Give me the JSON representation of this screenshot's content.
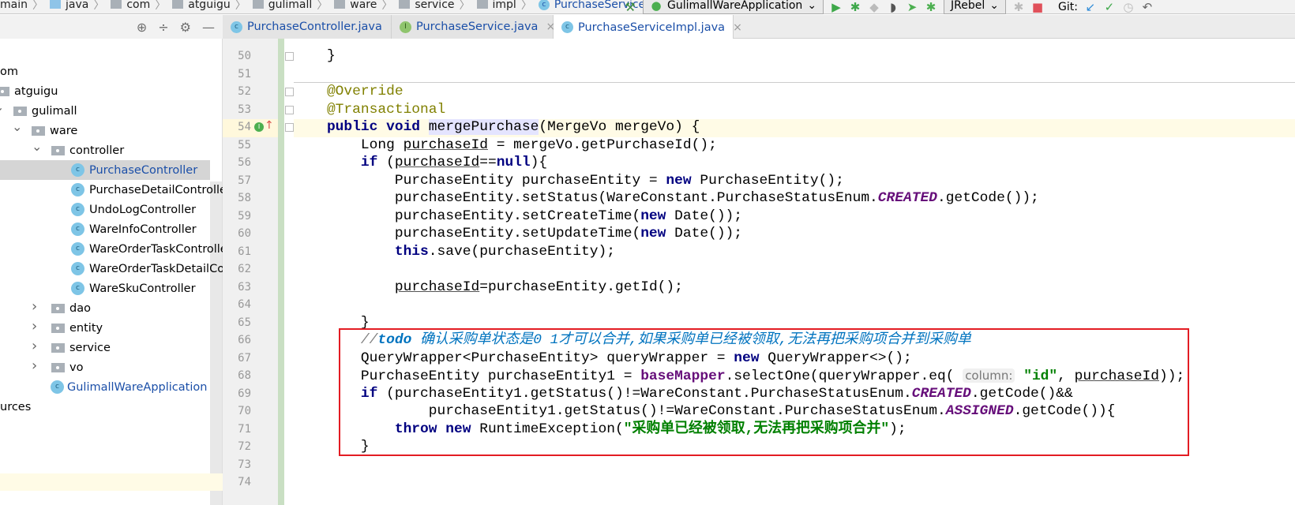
{
  "breadcrumb": [
    {
      "label": "main",
      "icon": "folder-icon"
    },
    {
      "label": "java",
      "icon": "java-source-folder-icon"
    },
    {
      "label": "com",
      "icon": "package-icon"
    },
    {
      "label": "atguigu",
      "icon": "package-icon"
    },
    {
      "label": "gulimall",
      "icon": "package-icon"
    },
    {
      "label": "ware",
      "icon": "package-icon"
    },
    {
      "label": "service",
      "icon": "package-icon"
    },
    {
      "label": "impl",
      "icon": "package-icon"
    },
    {
      "label": "PurchaseServiceImpl",
      "icon": "class-icon"
    }
  ],
  "toolbar": {
    "run_config": "GulimallWareApplication",
    "jrebel": "JRebel",
    "git_label": "Git:"
  },
  "tabs": [
    {
      "label": "PurchaseController.java",
      "icon": "class-icon",
      "active": false
    },
    {
      "label": "PurchaseService.java",
      "icon": "interface-icon",
      "active": false
    },
    {
      "label": "PurchaseServiceImpl.java",
      "icon": "class-icon",
      "active": true
    }
  ],
  "tree": [
    {
      "label": "om",
      "type": "text",
      "depth": 0
    },
    {
      "label": "atguigu",
      "type": "package",
      "depth": 0
    },
    {
      "label": "gulimall",
      "type": "package",
      "depth": 1,
      "expanded": true
    },
    {
      "label": "ware",
      "type": "package",
      "depth": 2,
      "expanded": true
    },
    {
      "label": "controller",
      "type": "package",
      "depth": 3,
      "expanded": true
    },
    {
      "label": "PurchaseController",
      "type": "class",
      "depth": 4,
      "selected": true
    },
    {
      "label": "PurchaseDetailController",
      "type": "class",
      "depth": 4
    },
    {
      "label": "UndoLogController",
      "type": "class",
      "depth": 4
    },
    {
      "label": "WareInfoController",
      "type": "class",
      "depth": 4
    },
    {
      "label": "WareOrderTaskController",
      "type": "class",
      "depth": 4
    },
    {
      "label": "WareOrderTaskDetailController",
      "type": "class",
      "depth": 4
    },
    {
      "label": "WareSkuController",
      "type": "class",
      "depth": 4
    },
    {
      "label": "dao",
      "type": "package",
      "depth": 3,
      "expanded": false
    },
    {
      "label": "entity",
      "type": "package",
      "depth": 3,
      "expanded": false
    },
    {
      "label": "service",
      "type": "package",
      "depth": 3,
      "expanded": false
    },
    {
      "label": "vo",
      "type": "package",
      "depth": 3,
      "expanded": false
    },
    {
      "label": "GulimallWareApplication",
      "type": "app",
      "depth": 3
    },
    {
      "label": "urces",
      "type": "text",
      "depth": 0
    }
  ],
  "code": {
    "lines": [
      {
        "n": "50",
        "t": [
          [
            "",
            "    }"
          ]
        ]
      },
      {
        "n": "51",
        "t": []
      },
      {
        "n": "52",
        "t": [
          [
            "ann",
            "    @Override"
          ]
        ]
      },
      {
        "n": "53",
        "t": [
          [
            "ann",
            "    @Transactional"
          ]
        ]
      },
      {
        "n": "54",
        "t": [
          [
            "kw",
            "    public void "
          ],
          [
            "hl",
            "mergePurchase"
          ],
          [
            "",
            "(MergeVo mergeVo) {"
          ]
        ]
      },
      {
        "n": "55",
        "t": [
          [
            "",
            "        Long "
          ],
          [
            "ul",
            "purchaseId"
          ],
          [
            "",
            " = mergeVo.getPurchaseId();"
          ]
        ]
      },
      {
        "n": "56",
        "t": [
          [
            "kw",
            "        if "
          ],
          [
            "",
            "("
          ],
          [
            "ul",
            "purchaseId"
          ],
          [
            "",
            "=="
          ],
          [
            "kw",
            "null"
          ],
          [
            "",
            "){"
          ]
        ]
      },
      {
        "n": "57",
        "t": [
          [
            "",
            "            PurchaseEntity purchaseEntity = "
          ],
          [
            "kw",
            "new "
          ],
          [
            "",
            "PurchaseEntity();"
          ]
        ]
      },
      {
        "n": "58",
        "t": [
          [
            "",
            "            purchaseEntity.setStatus(WareConstant.PurchaseStatusEnum."
          ],
          [
            "en",
            "CREATED"
          ],
          [
            "",
            ".getCode());"
          ]
        ]
      },
      {
        "n": "59",
        "t": [
          [
            "",
            "            purchaseEntity.setCreateTime("
          ],
          [
            "kw",
            "new "
          ],
          [
            "",
            "Date());"
          ]
        ]
      },
      {
        "n": "60",
        "t": [
          [
            "",
            "            purchaseEntity.setUpdateTime("
          ],
          [
            "kw",
            "new "
          ],
          [
            "",
            "Date());"
          ]
        ]
      },
      {
        "n": "61",
        "t": [
          [
            "kw",
            "            this"
          ],
          [
            "",
            ".save(purchaseEntity);"
          ]
        ]
      },
      {
        "n": "62",
        "t": []
      },
      {
        "n": "63",
        "t": [
          [
            "",
            "            "
          ],
          [
            "ul",
            "purchaseId"
          ],
          [
            "",
            "=purchaseEntity.getId();"
          ]
        ]
      },
      {
        "n": "64",
        "t": []
      },
      {
        "n": "65",
        "t": [
          [
            "",
            "        }"
          ]
        ]
      },
      {
        "n": "66",
        "t": [
          [
            "cms",
            "        //"
          ],
          [
            "cmk",
            "todo "
          ],
          [
            "cm",
            "确认采购单状态是0 1才可以合并,如果采购单已经被领取,无法再把采购项合并到采购单"
          ]
        ]
      },
      {
        "n": "67",
        "t": [
          [
            "",
            "        QueryWrapper<PurchaseEntity> queryWrapper = "
          ],
          [
            "kw",
            "new "
          ],
          [
            "",
            "QueryWrapper<>();"
          ]
        ]
      },
      {
        "n": "68",
        "t": [
          [
            "",
            "        PurchaseEntity purchaseEntity1 = "
          ],
          [
            "fld",
            "baseMapper"
          ],
          [
            "",
            ".selectOne(queryWrapper.eq( "
          ],
          [
            "hint",
            "column:"
          ],
          [
            "st",
            " \"id\""
          ],
          [
            "",
            ", "
          ],
          [
            "ul",
            "purchaseId"
          ],
          [
            "",
            "));"
          ]
        ]
      },
      {
        "n": "69",
        "t": [
          [
            "kw",
            "        if "
          ],
          [
            "",
            "(purchaseEntity1.getStatus()!=WareConstant.PurchaseStatusEnum."
          ],
          [
            "en",
            "CREATED"
          ],
          [
            "",
            ".getCode()&&"
          ]
        ]
      },
      {
        "n": "70",
        "t": [
          [
            "",
            "                purchaseEntity1.getStatus()!=WareConstant.PurchaseStatusEnum."
          ],
          [
            "en",
            "ASSIGNED"
          ],
          [
            "",
            ".getCode()){"
          ]
        ]
      },
      {
        "n": "71",
        "t": [
          [
            "kw",
            "            throw new "
          ],
          [
            "",
            "RuntimeException("
          ],
          [
            "st",
            "\"采购单已经被领取,无法再把采购项合并\""
          ],
          [
            "",
            ");"
          ]
        ]
      },
      {
        "n": "72",
        "t": [
          [
            "",
            "        }"
          ]
        ]
      },
      {
        "n": "73",
        "t": []
      },
      {
        "n": "74",
        "t": []
      }
    ]
  },
  "colors": {
    "highlight_box": "#e31c23",
    "keyword": "#000080",
    "annotation": "#808000",
    "comment": "#0073bf",
    "string": "#008000",
    "field": "#660e7a"
  }
}
